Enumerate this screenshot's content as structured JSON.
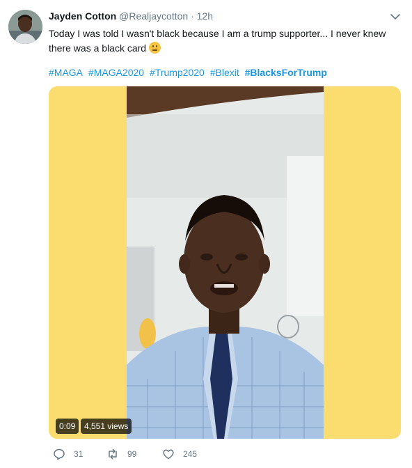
{
  "tweet": {
    "author_name": "Jayden Cotton",
    "handle": "@Realjaycotton",
    "separator": "·",
    "time": "12h",
    "text": "Today I was told I wasn't black because I am a trump supporter... I never knew there was a black card",
    "emoji": "confused-face-emoji",
    "hashtags": [
      {
        "text": "#MAGA",
        "bold": false
      },
      {
        "text": "#MAGA2020",
        "bold": false
      },
      {
        "text": "#Trump2020",
        "bold": false
      },
      {
        "text": "#Blexit",
        "bold": false
      },
      {
        "text": "#BlacksForTrump",
        "bold": true
      }
    ],
    "video": {
      "duration": "0:09",
      "views": "4,551 views",
      "background_color": "#fbdd6f"
    },
    "actions": {
      "replies": "31",
      "retweets": "99",
      "likes": "245"
    }
  },
  "colors": {
    "link": "#1b95e0",
    "muted": "#657786",
    "text": "#14171a"
  }
}
